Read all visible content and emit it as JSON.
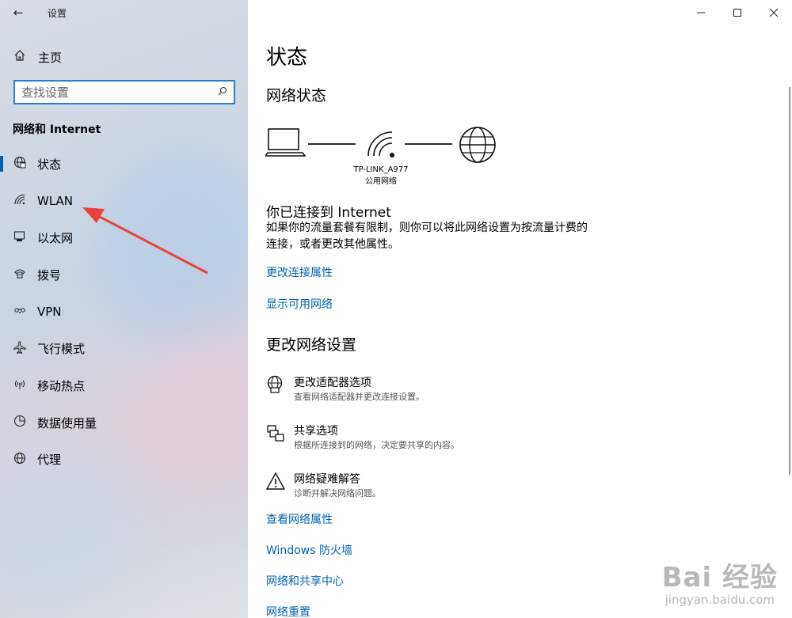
{
  "window": {
    "title": "设置",
    "back_glyph": "←",
    "controls": [
      "minimize-icon",
      "maximize-icon",
      "close-icon"
    ]
  },
  "sidebar": {
    "home_label": "主页",
    "search_placeholder": "查找设置",
    "section_title": "网络和 Internet",
    "items": [
      {
        "label": "状态",
        "icon": "globe-status-icon",
        "active": true
      },
      {
        "label": "WLAN",
        "icon": "wifi-icon",
        "active": false
      },
      {
        "label": "以太网",
        "icon": "ethernet-icon",
        "active": false
      },
      {
        "label": "拨号",
        "icon": "dialup-icon",
        "active": false
      },
      {
        "label": "VPN",
        "icon": "vpn-icon",
        "active": false
      },
      {
        "label": "飞行模式",
        "icon": "airplane-icon",
        "active": false
      },
      {
        "label": "移动热点",
        "icon": "hotspot-icon",
        "active": false
      },
      {
        "label": "数据使用量",
        "icon": "data-usage-icon",
        "active": false
      },
      {
        "label": "代理",
        "icon": "proxy-globe-icon",
        "active": false
      }
    ],
    "annotation_color": "#e8433a"
  },
  "main": {
    "page_title": "状态",
    "network_status_heading": "网络状态",
    "network_name": "TP-LINK_A977",
    "network_type": "公用网络",
    "connected_heading": "你已连接到 Internet",
    "connected_desc": "如果你的流量套餐有限制，则你可以将此网络设置为按流量计费的连接，或者更改其他属性。",
    "link_change_connection": "更改连接属性",
    "link_show_networks": "显示可用网络",
    "change_settings_heading": "更改网络设置",
    "settings": [
      {
        "title": "更改适配器选项",
        "desc": "查看网络适配器并更改连接设置。",
        "icon": "adapter-globe-icon"
      },
      {
        "title": "共享选项",
        "desc": "根据所连接到的网络，决定要共享的内容。",
        "icon": "sharing-icon"
      },
      {
        "title": "网络疑难解答",
        "desc": "诊断并解决网络问题。",
        "icon": "warning-icon"
      }
    ],
    "links_bottom": [
      "查看网络属性",
      "Windows 防火墙",
      "网络和共享中心",
      "网络重置"
    ],
    "accent_color": "#0063b1"
  },
  "watermark": {
    "line1": "Bai 经验",
    "line2": "jingyan.baidu.com"
  }
}
